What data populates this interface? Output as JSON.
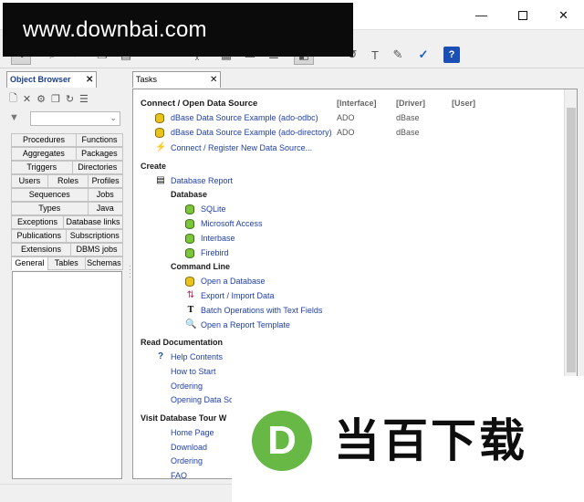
{
  "watermark": {
    "url": "www.downbai.com",
    "logo_letter": "D",
    "brand_text": "当百下载"
  },
  "window": {
    "min_glyph": "—",
    "close_glyph": "✕"
  },
  "toolbar": {
    "icons": [
      "pointer-icon",
      "find-icon",
      "cut-icon",
      "copy-icon",
      "paste-icon",
      "undo-icon",
      "redo-icon",
      "format-icon",
      "grid-icon",
      "window-icon",
      "list-icon",
      "clear-icon",
      "text-icon",
      "edit-icon",
      "checklist-icon",
      "help-icon"
    ],
    "help_label": "?",
    "text_label": "T",
    "check_label": "✓"
  },
  "object_browser": {
    "tab_label": "Object Browser",
    "close_glyph": "✕",
    "filter_value": "",
    "tab_rows": [
      [
        "Procedures",
        "Functions"
      ],
      [
        "Aggregates",
        "Packages"
      ],
      [
        "Triggers",
        "Directories"
      ],
      [
        "Users",
        "Roles",
        "Profiles"
      ],
      [
        "Sequences",
        "Jobs"
      ],
      [
        "Types",
        "Java"
      ],
      [
        "Exceptions",
        "Database links"
      ],
      [
        "Publications",
        "Subscriptions"
      ],
      [
        "Extensions",
        "DBMS jobs"
      ],
      [
        "General",
        "Tables",
        "Schemas"
      ]
    ],
    "active_tab": "General"
  },
  "tasks": {
    "tab_label": "Tasks",
    "close_glyph": "✕",
    "connect": {
      "heading": "Connect / Open Data Source",
      "col_interface": "[Interface]",
      "col_driver": "[Driver]",
      "col_user": "[User]",
      "items": [
        {
          "label": "dBase Data Source Example (ado-odbc)",
          "interface": "ADO",
          "driver": "dBase"
        },
        {
          "label": "dBase Data Source Example (ado-directory)",
          "interface": "ADO",
          "driver": "dBase"
        }
      ],
      "register_label": "Connect / Register New Data Source..."
    },
    "create": {
      "heading": "Create",
      "report_label": "Database Report",
      "database_heading": "Database",
      "databases": [
        "SQLite",
        "Microsoft Access",
        "Interbase",
        "Firebird"
      ],
      "cmdline_heading": "Command Line",
      "cmdline_items": [
        "Open a Database",
        "Export / Import Data",
        "Batch Operations with Text Fields",
        "Open a Report Template"
      ]
    },
    "docs": {
      "heading": "Read Documentation",
      "items": [
        "Help Contents",
        "How to Start",
        "Ordering",
        "Opening Data So"
      ]
    },
    "tour": {
      "heading": "Visit Database Tour W",
      "items": [
        "Home Page",
        "Download",
        "Ordering",
        "FAQ"
      ]
    }
  }
}
